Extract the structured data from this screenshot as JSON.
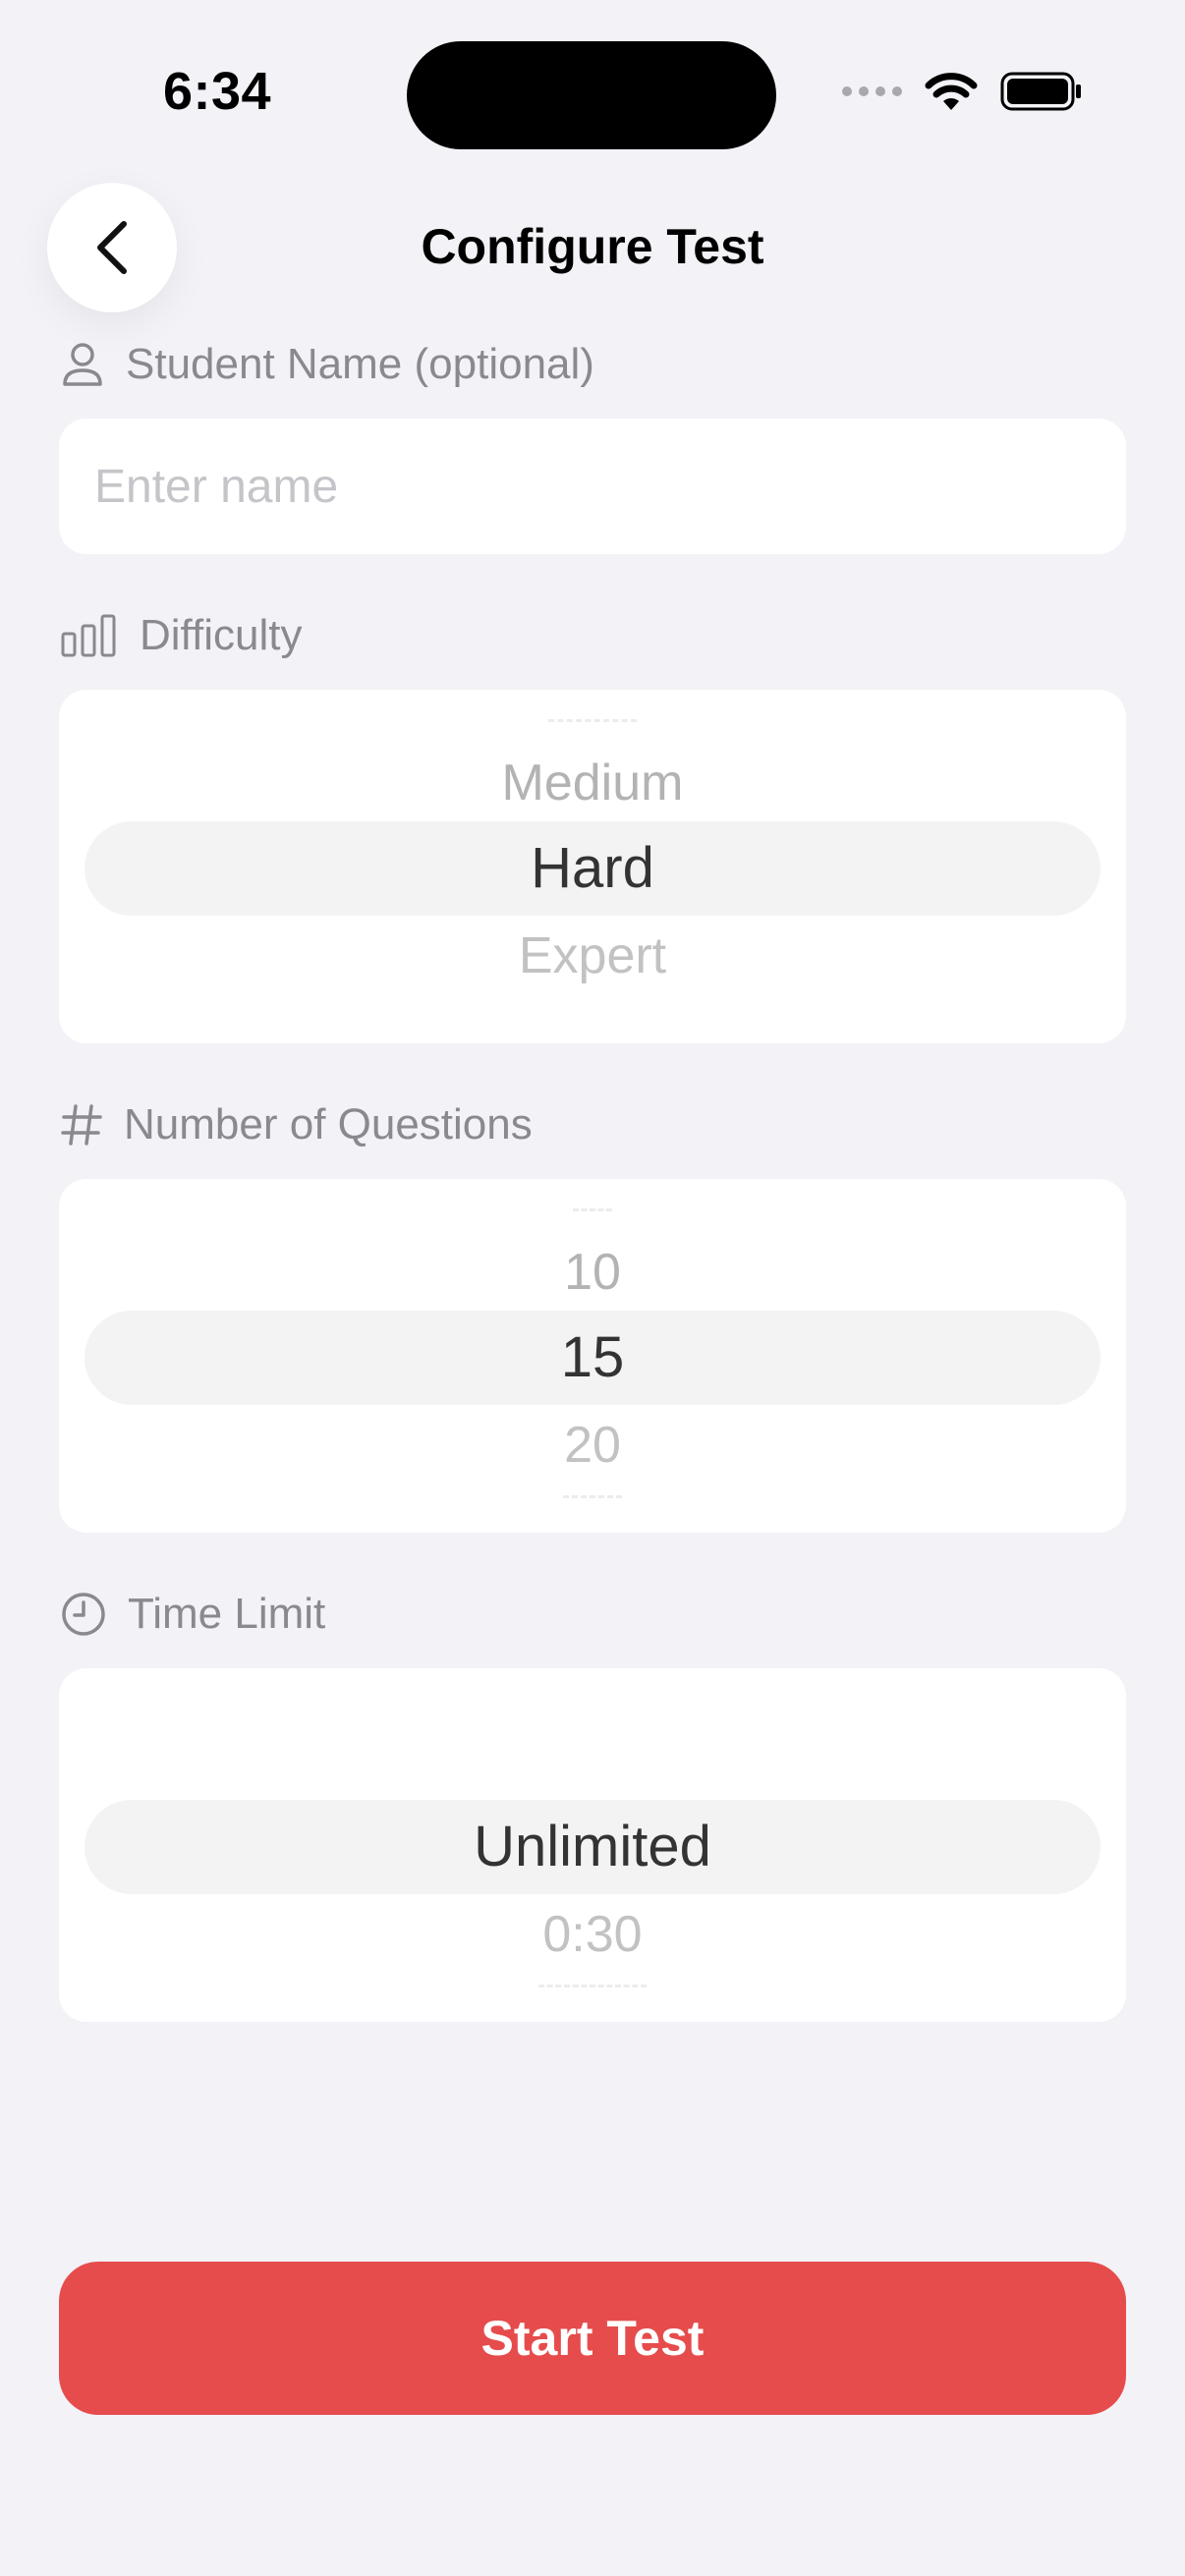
{
  "status_bar": {
    "time": "6:34"
  },
  "header": {
    "title": "Configure Test",
    "back_icon": "chevron-left-icon"
  },
  "student_name": {
    "label": "Student Name (optional)",
    "placeholder": "Enter name",
    "value": "",
    "icon": "person-icon"
  },
  "difficulty": {
    "label": "Difficulty",
    "icon": "bar-chart-icon",
    "above": "Medium",
    "selected": "Hard",
    "below": "Expert"
  },
  "questions": {
    "label": "Number of Questions",
    "icon": "hash-icon",
    "above": "10",
    "selected": "15",
    "below": "20"
  },
  "time_limit": {
    "label": "Time Limit",
    "icon": "clock-icon",
    "above": "",
    "selected": "Unlimited",
    "below": "0:30"
  },
  "start_button": {
    "label": "Start Test"
  },
  "colors": {
    "background": "#f2f2f7",
    "accent": "#e64c4c",
    "label": "#8a8a8e"
  }
}
